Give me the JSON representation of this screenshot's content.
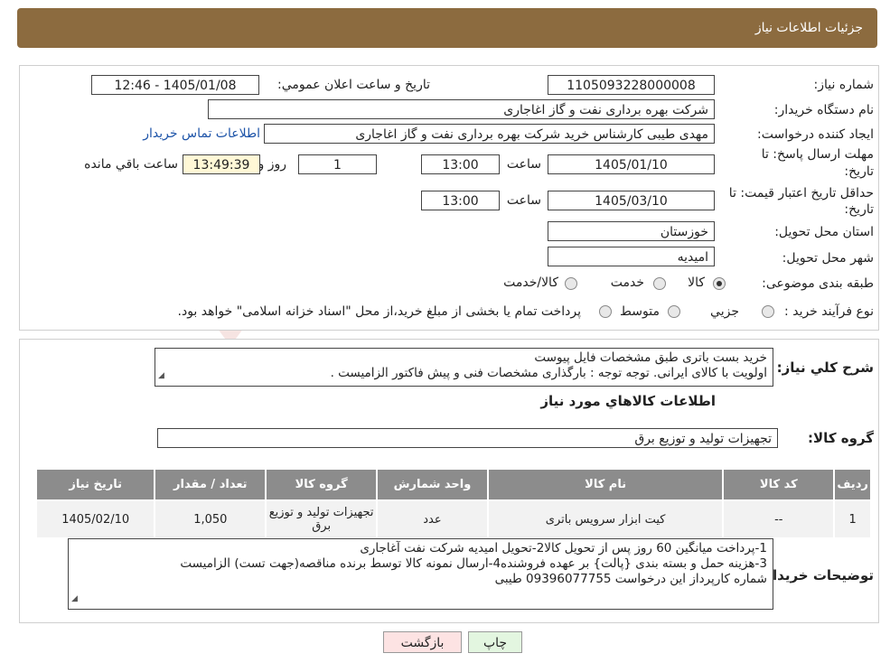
{
  "header": {
    "title": "جزئیات اطلاعات نیاز"
  },
  "fields": {
    "need_number_label": "شماره نیاز:",
    "need_number": "1105093228000008",
    "announce_label": "تاریخ و ساعت اعلان عمومي:",
    "announce_value": "1405/01/08 - 12:46",
    "buyer_org_label": "نام دستگاه خريدار:",
    "buyer_org": "شرکت بهره برداری نفت و گاز اغاجاری",
    "creator_label": "ايجاد کننده درخواست:",
    "creator": "مهدی طیبی کارشناس خرید شرکت بهره برداری نفت و گاز اغاجاری",
    "contact_link": "اطلاعات تماس خریدار",
    "deadline_label_1": "مهلت ارسال پاسخ: تا",
    "deadline_label_2": "تاریخ:",
    "deadline_date": "1405/01/10",
    "time_label": "ساعت",
    "deadline_time": "13:00",
    "days_value": "1",
    "days_label": "روز و",
    "remaining_time": "13:49:39",
    "remaining_label": "ساعت باقي مانده",
    "validity_label_1": "حداقل تاريخ اعتبار قيمت: تا",
    "validity_label_2": "تاریخ:",
    "validity_date": "1405/03/10",
    "validity_time": "13:00",
    "province_label": "استان محل تحویل:",
    "province": "خوزستان",
    "city_label": "شهر محل تحویل:",
    "city": "امیدیه",
    "category_label": "طبقه بندی موضوعی:",
    "category_options": [
      "کالا",
      "خدمت",
      "کالا/خدمت"
    ],
    "category_selected": "کالا",
    "process_label": "نوع فرآيند خريد :",
    "process_options": [
      "جزيي",
      "متوسط"
    ],
    "process_note": "پرداخت تمام یا بخشی از مبلغ خرید،از محل \"اسناد خزانه اسلامی\" خواهد بود."
  },
  "desc": {
    "label": "شرح کلي نياز:",
    "line1": "خرید بست باتری طبق مشخصات فایل پیوست",
    "line2": "اولویت با کالای ایرانی. توجه توجه : بارگذاری مشخصات فنی و پیش فاکتور الزامیست ."
  },
  "goods": {
    "section_title": "اطلاعات کالاهاي مورد نياز",
    "group_label": "گروه کالا:",
    "group_value": "تجهیزات تولید و توزیع برق",
    "columns": [
      "رديف",
      "کد کالا",
      "نام کالا",
      "واحد شمارش",
      "گروه کالا",
      "تعداد / مقدار",
      "تاريخ نياز"
    ],
    "rows": [
      [
        "1",
        "--",
        "کیت ابزار سرویس باتری",
        "عدد",
        "تجهیزات تولید و توزیع برق",
        "1,050",
        "1405/02/10"
      ]
    ]
  },
  "buyer_notes": {
    "label": "توضيحات خريدار:",
    "line1": "1-پرداخت میانگین 60 روز پس از تحویل کالا2-تحویل امیدیه شرکت نفت آغاجاری",
    "line2": "3-هزینه حمل  و بسته بندی {پالت} بر عهده فروشنده4-ارسال نمونه کالا توسط برنده مناقصه(جهت تست) الزامیست",
    "line3": "شماره کارپرداز این درخواست 09396077755 طیبی"
  },
  "buttons": {
    "print": "چاپ",
    "back": "بازگشت"
  },
  "watermark": {
    "text": "AriaTender.neT"
  },
  "colors": {
    "header": "#8c6b3f",
    "table_header": "#8c8c8c",
    "back_button": "#fde3e3",
    "print_button": "#e3f6e0",
    "highlight": "#fff8d6"
  }
}
